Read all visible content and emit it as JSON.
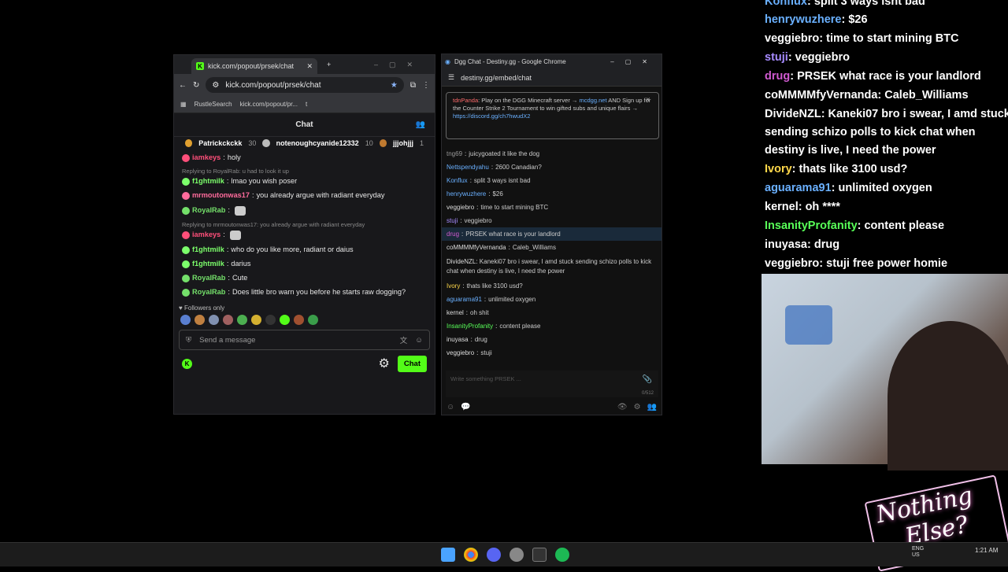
{
  "kick": {
    "tab_title": "kick.com/popout/prsek/chat",
    "url": "kick.com/popout/prsek/chat",
    "bookmarks": [
      "RustleSearch",
      "kick.com/popout/pr...",
      "t"
    ],
    "chat_header": "Chat",
    "leaders": [
      {
        "rank": "1",
        "name": "Patrickckckk",
        "count": "30"
      },
      {
        "rank": "2",
        "name": "notenoughcyanide12332",
        "count": "10"
      },
      {
        "rank": "3",
        "name": "jjjohjjj",
        "count": "1"
      }
    ],
    "messages": [
      {
        "user": "iamkeys",
        "color": "#ff4f7a",
        "text": "holy",
        "reply": ""
      },
      {
        "user": "f1ghtmilk",
        "color": "#7cff6b",
        "text": "lmao you wish poser",
        "reply": "Replying to RoyalRab:  u had to look it up"
      },
      {
        "user": "mrmoutonwas17",
        "color": "#ff6b9c",
        "text": "you already argue with radiant everyday",
        "reply": ""
      },
      {
        "user": "RoyalRab",
        "color": "#74e06a",
        "text": "",
        "reply": ""
      },
      {
        "user": "iamkeys",
        "color": "#ff4f7a",
        "text": "",
        "reply": "Replying to mrmoutonwas17: you already argue with radiant everyday"
      },
      {
        "user": "f1ghtmilk",
        "color": "#7cff6b",
        "text": "who do you like more, radiant or daius",
        "reply": ""
      },
      {
        "user": "f1ghtmilk",
        "color": "#7cff6b",
        "text": "darius",
        "reply": ""
      },
      {
        "user": "RoyalRab",
        "color": "#74e06a",
        "text": "Cute",
        "reply": ""
      },
      {
        "user": "RoyalRab",
        "color": "#74e06a",
        "text": "Does little bro warn you before he starts raw dogging?",
        "reply": ""
      }
    ],
    "followers_only": "Followers only",
    "input_placeholder": "Send a message",
    "chat_button": "Chat"
  },
  "dgg": {
    "window_title": "Dgg Chat - Destiny.gg - Google Chrome",
    "url": "destiny.gg/embed/chat",
    "notice": {
      "user": "tdnPanda",
      "text1": "Play on the DGG Minecraft server",
      "link1": "mcdgg.net",
      "text2": "AND Sign up for the Counter Strike 2 Tournament to win gifted subs and unique flairs",
      "link2": "https://discord.gg/ch7hwudX2"
    },
    "lines": [
      {
        "user": "tng69",
        "color": "#999",
        "text": "juicygoated it like the dog",
        "hl": false
      },
      {
        "user": "Nettspendyahu",
        "color": "#6ab0ff",
        "text": "2600 Canadian?",
        "hl": false
      },
      {
        "user": "Konflux",
        "color": "#6ab0ff",
        "text": "split 3 ways isnt bad",
        "hl": false
      },
      {
        "user": "henrywuzhere",
        "color": "#6ab0ff",
        "text": "$26",
        "hl": false
      },
      {
        "user": "veggiebro",
        "color": "#ddd",
        "text": "time to start mining BTC",
        "hl": false
      },
      {
        "user": "stuji",
        "color": "#a78bff",
        "text": "veggiebro",
        "hl": false
      },
      {
        "user": "drug",
        "color": "#d05ad0",
        "text": "PRSEK what race is your landlord",
        "hl": true
      },
      {
        "user": "coMMMMfyVernanda",
        "color": "#ddd",
        "text": "Caleb_Williams",
        "hl": false
      },
      {
        "user": "DivideNZL",
        "color": "#ddd",
        "text": "Kaneki07 bro i swear, I amd stuck sending schizo polls to kick chat when destiny is live, I need the power",
        "hl": false
      },
      {
        "user": "Ivory",
        "color": "#ffd84a",
        "text": "thats like 3100 usd?",
        "hl": false
      },
      {
        "user": "aguarama91",
        "color": "#6ab0ff",
        "text": "unlimited oxygen",
        "hl": false
      },
      {
        "user": "kernel",
        "color": "#ddd",
        "text": "oh shit",
        "hl": false
      },
      {
        "user": "InsanityProfanity",
        "color": "#58ff58",
        "text": "content please",
        "hl": false
      },
      {
        "user": "inuyasa",
        "color": "#ddd",
        "text": "drug",
        "hl": false
      },
      {
        "user": "veggiebro",
        "color": "#ddd",
        "text": "stuji",
        "hl": false
      }
    ],
    "input_placeholder": "Write something PRSEK ...",
    "char_count": "0/512"
  },
  "overlay": [
    {
      "user": "Konflux",
      "color": "#6ab0ff",
      "text": "split 3 ways isnt bad"
    },
    {
      "user": "henrywuzhere",
      "color": "#6ab0ff",
      "text": "$26"
    },
    {
      "user": "veggiebro",
      "color": "#fff",
      "text": "time to start mining BTC"
    },
    {
      "user": "stuji",
      "color": "#a78bff",
      "text": "veggiebro"
    },
    {
      "user": "drug",
      "color": "#d05ad0",
      "text": "PRSEK what race is your landlord"
    },
    {
      "user": "coMMMMfyVernanda",
      "color": "#fff",
      "text": "Caleb_Williams"
    },
    {
      "user": "DivideNZL",
      "color": "#fff",
      "text": "Kaneki07 bro i swear, I amd stuck"
    },
    {
      "user": "",
      "color": "#fff",
      "text": "sending schizo polls to kick chat when"
    },
    {
      "user": "",
      "color": "#fff",
      "text": "destiny is live, I need the power"
    },
    {
      "user": "Ivory",
      "color": "#ffd84a",
      "text": "thats like 3100 usd?"
    },
    {
      "user": "aguarama91",
      "color": "#6ab0ff",
      "text": "unlimited oxygen"
    },
    {
      "user": "kernel",
      "color": "#fff",
      "text": "oh ****"
    },
    {
      "user": "InsanityProfanity",
      "color": "#58ff58",
      "text": "content please"
    },
    {
      "user": "inuyasa",
      "color": "#fff",
      "text": "drug"
    },
    {
      "user": "veggiebro",
      "color": "#fff",
      "text": "stuji"
    }
  ],
  "overlay_power": "free power homie",
  "neon": {
    "line1": "Nothing",
    "line2": "Else?"
  },
  "taskbar": {
    "lang": "ENG",
    "region": "US",
    "time": "1:21 AM"
  }
}
